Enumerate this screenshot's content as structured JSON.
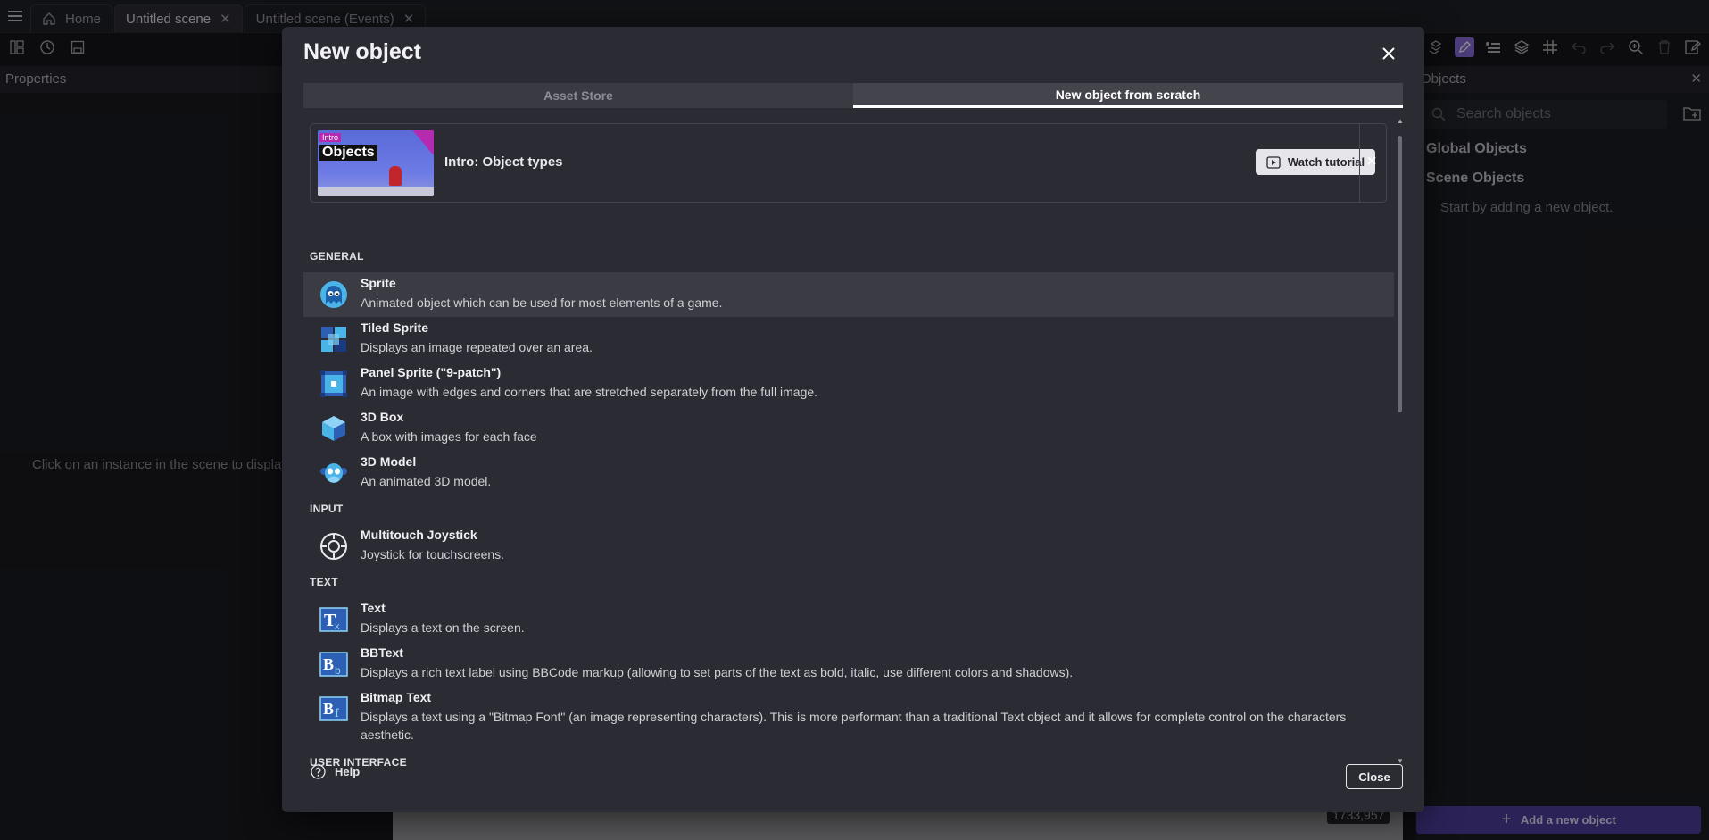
{
  "tabs": [
    {
      "label": "Home",
      "icon": "home-icon"
    },
    {
      "label": "Untitled scene"
    },
    {
      "label": "Untitled scene (Events)"
    }
  ],
  "left_panel": {
    "title": "Properties",
    "hint": "Click on an instance in the scene to display i"
  },
  "canvas": {
    "coords": "1733,957"
  },
  "right_panel": {
    "title": "Objects",
    "search_placeholder": "Search objects",
    "global_objects": "Global Objects",
    "scene_objects": "Scene Objects",
    "hint": "Start by adding a new object.",
    "add_button": "Add a new object"
  },
  "dialog": {
    "title": "New object",
    "tabs": [
      "Asset Store",
      "New object from scratch"
    ],
    "tutorial": {
      "thumb_tag": "Intro",
      "thumb_title": "Objects",
      "title": "Intro: Object types",
      "watch_label": "Watch tutorial"
    },
    "sections": {
      "general": "GENERAL",
      "input": "INPUT",
      "text": "TEXT",
      "ui": "USER INTERFACE"
    },
    "items": [
      {
        "name": "Sprite",
        "desc": "Animated object which can be used for most elements of a game.",
        "icon": "ghost-icon"
      },
      {
        "name": "Tiled Sprite",
        "desc": "Displays an image repeated over an area.",
        "icon": "tiles-icon"
      },
      {
        "name": "Panel Sprite (\"9-patch\")",
        "desc": "An image with edges and corners that are stretched separately from the full image.",
        "icon": "nine-patch-icon"
      },
      {
        "name": "3D Box",
        "desc": "A box with images for each face",
        "icon": "cube-icon"
      },
      {
        "name": "3D Model",
        "desc": "An animated 3D model.",
        "icon": "monkey-head-icon"
      },
      {
        "name": "Multitouch Joystick",
        "desc": "Joystick for touchscreens.",
        "icon": "joystick-icon"
      },
      {
        "name": "Text",
        "desc": "Displays a text on the screen.",
        "icon": "text-icon"
      },
      {
        "name": "BBText",
        "desc": "Displays a rich text label using BBCode markup (allowing to set parts of the text as bold, italic, use different colors and shadows).",
        "icon": "bbtext-icon"
      },
      {
        "name": "Bitmap Text",
        "desc": "Displays a text using a \"Bitmap Font\" (an image representing characters). This is more performant than a traditional Text object and it allows for complete control on the characters aesthetic.",
        "icon": "bitmap-text-icon"
      }
    ],
    "help_label": "Help",
    "close_label": "Close"
  },
  "colors": {
    "accent": "#8d6fe0",
    "dialog_bg": "#2b2c33",
    "add_button": "#4f3fa0"
  }
}
